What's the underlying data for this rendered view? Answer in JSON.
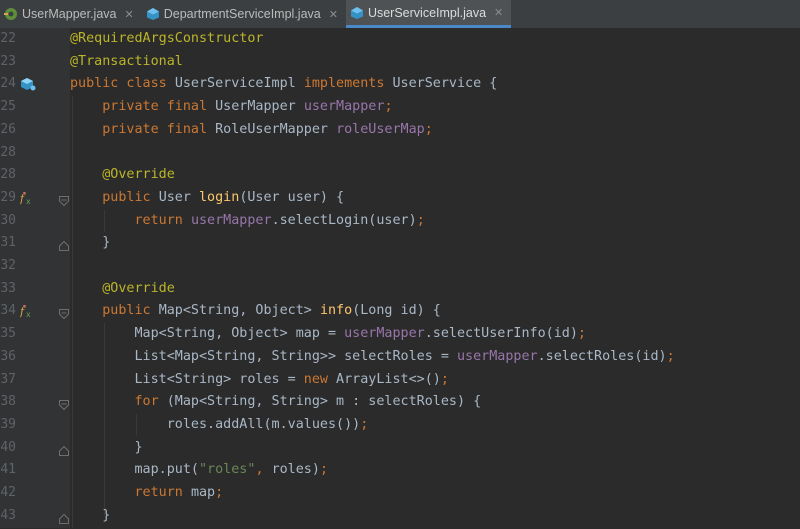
{
  "tabs": [
    {
      "label": "UserMapper.java",
      "icon": "mapper-interface-icon",
      "active": false
    },
    {
      "label": "DepartmentServiceImpl.java",
      "icon": "class-icon",
      "active": false
    },
    {
      "label": "UserServiceImpl.java",
      "icon": "class-icon",
      "active": true
    }
  ],
  "colors": {
    "keyword": "#cc7832",
    "annotation": "#bbb529",
    "field": "#9876aa",
    "method": "#ffc66d",
    "string": "#6a8759",
    "text": "#a9b7c6",
    "line_number": "#606366"
  },
  "lines": [
    {
      "n": "22",
      "tokens": [
        [
          "an",
          "@RequiredArgsConstructor"
        ]
      ]
    },
    {
      "n": "23",
      "tokens": [
        [
          "an",
          "@Transactional"
        ]
      ]
    },
    {
      "n": "24",
      "gutter_icon": "implementation-icon",
      "tokens": [
        [
          "kw",
          "public class "
        ],
        [
          "",
          "UserServiceImpl "
        ],
        [
          "kw",
          "implements "
        ],
        [
          "",
          "UserService {"
        ]
      ]
    },
    {
      "n": "25",
      "tokens": [
        [
          "",
          "    "
        ],
        [
          "kw",
          "private final "
        ],
        [
          "",
          "UserMapper "
        ],
        [
          "fd",
          "userMapper"
        ],
        [
          "kw",
          ";"
        ]
      ]
    },
    {
      "n": "26",
      "tokens": [
        [
          "",
          "    "
        ],
        [
          "kw",
          "private final "
        ],
        [
          "",
          "RoleUserMapper "
        ],
        [
          "fd",
          "roleUserMap"
        ],
        [
          "kw",
          ";"
        ]
      ]
    },
    {
      "n": "28",
      "tokens": []
    },
    {
      "n": "28",
      "tokens": [
        [
          "",
          "    "
        ],
        [
          "an",
          "@Override"
        ]
      ]
    },
    {
      "n": "29",
      "gutter_icon": "override-lambda-icon",
      "fold": "fold-start-icon",
      "tokens": [
        [
          "",
          "    "
        ],
        [
          "kw",
          "public "
        ],
        [
          "",
          "User "
        ],
        [
          "fn",
          "login"
        ],
        [
          "",
          "(User user) {"
        ]
      ]
    },
    {
      "n": "30",
      "tokens": [
        [
          "",
          "        "
        ],
        [
          "kw",
          "return "
        ],
        [
          "fd",
          "userMapper"
        ],
        [
          "",
          ".selectLogin(user)"
        ],
        [
          "kw",
          ";"
        ]
      ]
    },
    {
      "n": "31",
      "fold": "fold-end-icon",
      "tokens": [
        [
          "",
          "    }"
        ]
      ]
    },
    {
      "n": "32",
      "tokens": []
    },
    {
      "n": "33",
      "tokens": [
        [
          "",
          "    "
        ],
        [
          "an",
          "@Override"
        ]
      ]
    },
    {
      "n": "34",
      "gutter_icon": "override-lambda-icon",
      "fold": "fold-start-icon",
      "tokens": [
        [
          "",
          "    "
        ],
        [
          "kw",
          "public "
        ],
        [
          "",
          "Map<String, Object> "
        ],
        [
          "fn",
          "info"
        ],
        [
          "",
          "(Long id) {"
        ]
      ]
    },
    {
      "n": "35",
      "tokens": [
        [
          "",
          "        Map<String, Object> map = "
        ],
        [
          "fd",
          "userMapper"
        ],
        [
          "",
          ".selectUserInfo(id)"
        ],
        [
          "kw",
          ";"
        ]
      ]
    },
    {
      "n": "36",
      "tokens": [
        [
          "",
          "        List<Map<String, String>> selectRoles = "
        ],
        [
          "fd",
          "userMapper"
        ],
        [
          "",
          ".selectRoles(id)"
        ],
        [
          "kw",
          ";"
        ]
      ]
    },
    {
      "n": "37",
      "tokens": [
        [
          "",
          "        List<String> roles = "
        ],
        [
          "kw",
          "new "
        ],
        [
          "",
          "ArrayList<>()"
        ],
        [
          "kw",
          ";"
        ]
      ]
    },
    {
      "n": "38",
      "fold": "fold-start-icon",
      "tokens": [
        [
          "",
          "        "
        ],
        [
          "kw",
          "for "
        ],
        [
          "",
          "(Map<String, String> m : selectRoles) {"
        ]
      ]
    },
    {
      "n": "39",
      "tokens": [
        [
          "",
          "            roles.addAll(m.values())"
        ],
        [
          "kw",
          ";"
        ]
      ]
    },
    {
      "n": "40",
      "fold": "fold-end-icon",
      "tokens": [
        [
          "",
          "        }"
        ]
      ]
    },
    {
      "n": "41",
      "tokens": [
        [
          "",
          "        map.put("
        ],
        [
          "st",
          "\"roles\""
        ],
        [
          "kw",
          ", "
        ],
        [
          "",
          "roles)"
        ],
        [
          "kw",
          ";"
        ]
      ]
    },
    {
      "n": "42",
      "tokens": [
        [
          "",
          "        "
        ],
        [
          "kw",
          "return "
        ],
        [
          "",
          "map"
        ],
        [
          "kw",
          ";"
        ]
      ]
    },
    {
      "n": "43",
      "fold": "fold-end-icon",
      "tokens": [
        [
          "",
          "    }"
        ]
      ]
    }
  ]
}
